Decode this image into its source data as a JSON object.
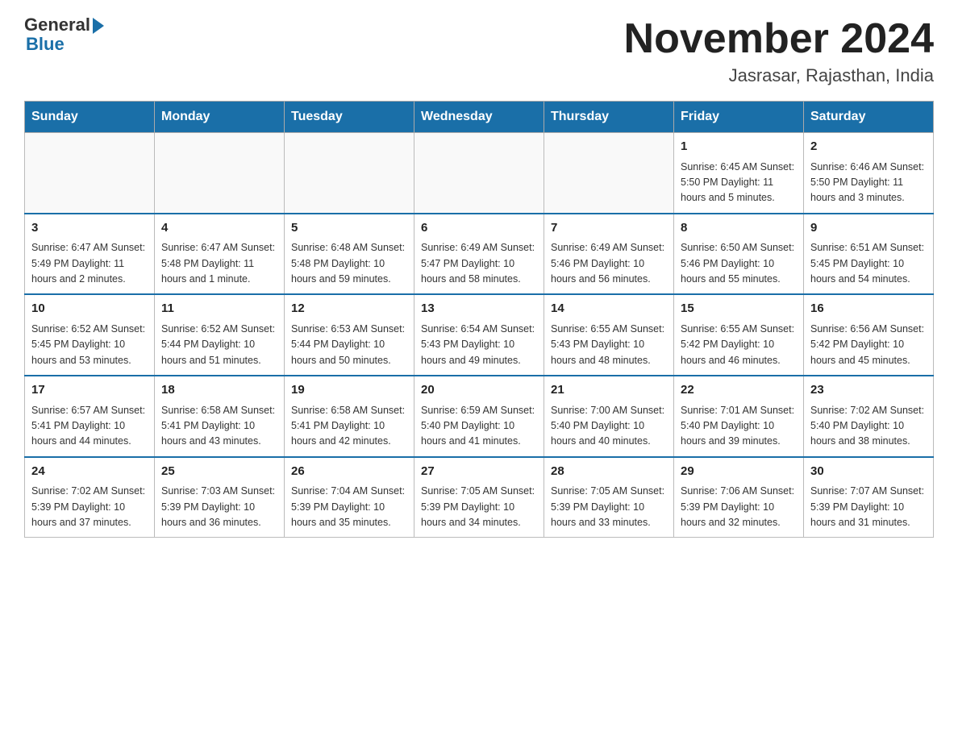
{
  "header": {
    "logo_general": "General",
    "logo_blue": "Blue",
    "month_title": "November 2024",
    "location": "Jasrasar, Rajasthan, India"
  },
  "days_of_week": [
    "Sunday",
    "Monday",
    "Tuesday",
    "Wednesday",
    "Thursday",
    "Friday",
    "Saturday"
  ],
  "weeks": [
    [
      {
        "day": "",
        "info": ""
      },
      {
        "day": "",
        "info": ""
      },
      {
        "day": "",
        "info": ""
      },
      {
        "day": "",
        "info": ""
      },
      {
        "day": "",
        "info": ""
      },
      {
        "day": "1",
        "info": "Sunrise: 6:45 AM\nSunset: 5:50 PM\nDaylight: 11 hours and 5 minutes."
      },
      {
        "day": "2",
        "info": "Sunrise: 6:46 AM\nSunset: 5:50 PM\nDaylight: 11 hours and 3 minutes."
      }
    ],
    [
      {
        "day": "3",
        "info": "Sunrise: 6:47 AM\nSunset: 5:49 PM\nDaylight: 11 hours and 2 minutes."
      },
      {
        "day": "4",
        "info": "Sunrise: 6:47 AM\nSunset: 5:48 PM\nDaylight: 11 hours and 1 minute."
      },
      {
        "day": "5",
        "info": "Sunrise: 6:48 AM\nSunset: 5:48 PM\nDaylight: 10 hours and 59 minutes."
      },
      {
        "day": "6",
        "info": "Sunrise: 6:49 AM\nSunset: 5:47 PM\nDaylight: 10 hours and 58 minutes."
      },
      {
        "day": "7",
        "info": "Sunrise: 6:49 AM\nSunset: 5:46 PM\nDaylight: 10 hours and 56 minutes."
      },
      {
        "day": "8",
        "info": "Sunrise: 6:50 AM\nSunset: 5:46 PM\nDaylight: 10 hours and 55 minutes."
      },
      {
        "day": "9",
        "info": "Sunrise: 6:51 AM\nSunset: 5:45 PM\nDaylight: 10 hours and 54 minutes."
      }
    ],
    [
      {
        "day": "10",
        "info": "Sunrise: 6:52 AM\nSunset: 5:45 PM\nDaylight: 10 hours and 53 minutes."
      },
      {
        "day": "11",
        "info": "Sunrise: 6:52 AM\nSunset: 5:44 PM\nDaylight: 10 hours and 51 minutes."
      },
      {
        "day": "12",
        "info": "Sunrise: 6:53 AM\nSunset: 5:44 PM\nDaylight: 10 hours and 50 minutes."
      },
      {
        "day": "13",
        "info": "Sunrise: 6:54 AM\nSunset: 5:43 PM\nDaylight: 10 hours and 49 minutes."
      },
      {
        "day": "14",
        "info": "Sunrise: 6:55 AM\nSunset: 5:43 PM\nDaylight: 10 hours and 48 minutes."
      },
      {
        "day": "15",
        "info": "Sunrise: 6:55 AM\nSunset: 5:42 PM\nDaylight: 10 hours and 46 minutes."
      },
      {
        "day": "16",
        "info": "Sunrise: 6:56 AM\nSunset: 5:42 PM\nDaylight: 10 hours and 45 minutes."
      }
    ],
    [
      {
        "day": "17",
        "info": "Sunrise: 6:57 AM\nSunset: 5:41 PM\nDaylight: 10 hours and 44 minutes."
      },
      {
        "day": "18",
        "info": "Sunrise: 6:58 AM\nSunset: 5:41 PM\nDaylight: 10 hours and 43 minutes."
      },
      {
        "day": "19",
        "info": "Sunrise: 6:58 AM\nSunset: 5:41 PM\nDaylight: 10 hours and 42 minutes."
      },
      {
        "day": "20",
        "info": "Sunrise: 6:59 AM\nSunset: 5:40 PM\nDaylight: 10 hours and 41 minutes."
      },
      {
        "day": "21",
        "info": "Sunrise: 7:00 AM\nSunset: 5:40 PM\nDaylight: 10 hours and 40 minutes."
      },
      {
        "day": "22",
        "info": "Sunrise: 7:01 AM\nSunset: 5:40 PM\nDaylight: 10 hours and 39 minutes."
      },
      {
        "day": "23",
        "info": "Sunrise: 7:02 AM\nSunset: 5:40 PM\nDaylight: 10 hours and 38 minutes."
      }
    ],
    [
      {
        "day": "24",
        "info": "Sunrise: 7:02 AM\nSunset: 5:39 PM\nDaylight: 10 hours and 37 minutes."
      },
      {
        "day": "25",
        "info": "Sunrise: 7:03 AM\nSunset: 5:39 PM\nDaylight: 10 hours and 36 minutes."
      },
      {
        "day": "26",
        "info": "Sunrise: 7:04 AM\nSunset: 5:39 PM\nDaylight: 10 hours and 35 minutes."
      },
      {
        "day": "27",
        "info": "Sunrise: 7:05 AM\nSunset: 5:39 PM\nDaylight: 10 hours and 34 minutes."
      },
      {
        "day": "28",
        "info": "Sunrise: 7:05 AM\nSunset: 5:39 PM\nDaylight: 10 hours and 33 minutes."
      },
      {
        "day": "29",
        "info": "Sunrise: 7:06 AM\nSunset: 5:39 PM\nDaylight: 10 hours and 32 minutes."
      },
      {
        "day": "30",
        "info": "Sunrise: 7:07 AM\nSunset: 5:39 PM\nDaylight: 10 hours and 31 minutes."
      }
    ]
  ]
}
